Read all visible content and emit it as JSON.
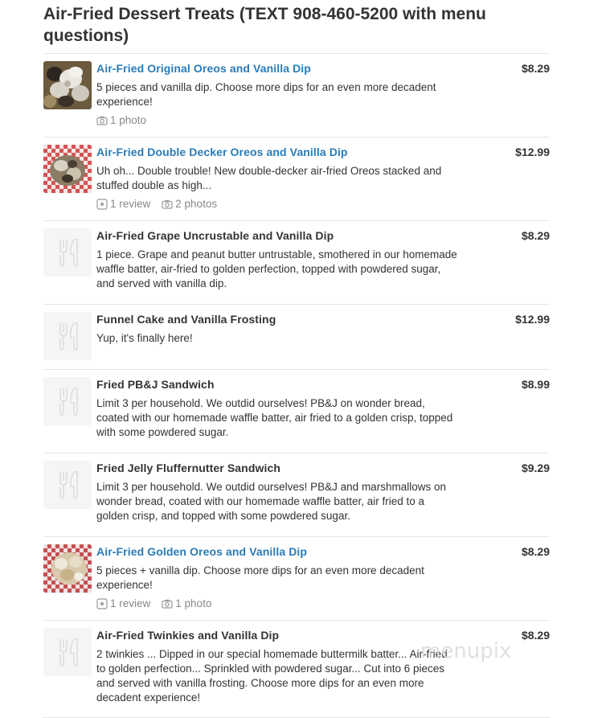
{
  "section": {
    "title": "Air-Fried Dessert Treats (TEXT 908-460-5200 with menu questions)"
  },
  "items": [
    {
      "name": "Air-Fried Original Oreos and Vanilla Dip",
      "price": "$8.29",
      "description": "5 pieces and vanilla dip. Choose more dips for an even more decadent experience!",
      "reviews": "",
      "photos": "1 photo",
      "has_photo": true,
      "thumb_icon": "oreo-photo"
    },
    {
      "name": "Air-Fried Double Decker Oreos and Vanilla Dip",
      "price": "$12.99",
      "description": "Uh oh... Double trouble! New double-decker air-fried Oreos stacked and stuffed double as high...",
      "reviews": "1 review",
      "photos": "2 photos",
      "has_photo": true,
      "thumb_icon": "double-oreo-photo"
    },
    {
      "name": "Air-Fried Grape Uncrustable and Vanilla Dip",
      "price": "$8.29",
      "description": "1 piece. Grape and peanut butter untrustable, smothered in our homemade waffle batter, air-fried to golden perfection, topped with powdered sugar, and served with vanilla dip.",
      "reviews": "",
      "photos": "",
      "has_photo": false,
      "thumb_icon": "fork-knife-icon"
    },
    {
      "name": "Funnel Cake and Vanilla Frosting",
      "price": "$12.99",
      "description": "Yup, it's finally here!",
      "reviews": "",
      "photos": "",
      "has_photo": false,
      "thumb_icon": "fork-knife-icon"
    },
    {
      "name": "Fried PB&J Sandwich",
      "price": "$8.99",
      "description": "Limit 3 per household. We outdid ourselves! PB&J on wonder bread, coated with our homemade waffle batter, air fried to a golden crisp, topped with some powdered sugar.",
      "reviews": "",
      "photos": "",
      "has_photo": false,
      "thumb_icon": "fork-knife-icon"
    },
    {
      "name": "Fried Jelly Fluffernutter Sandwich",
      "price": "$9.29",
      "description": "Limit 3 per household. We outdid ourselves! PB&J and marshmallows on wonder bread, coated with our homemade waffle batter, air fried to a golden crisp, and topped with some powdered sugar.",
      "reviews": "",
      "photos": "",
      "has_photo": false,
      "thumb_icon": "fork-knife-icon"
    },
    {
      "name": "Air-Fried Golden Oreos and Vanilla Dip",
      "price": "$8.29",
      "description": "5 pieces + vanilla dip. Choose more dips for an even more decadent experience!",
      "reviews": "1 review",
      "photos": "1 photo",
      "has_photo": true,
      "thumb_icon": "golden-oreo-photo"
    },
    {
      "name": "Air-Fried Twinkies and Vanilla Dip",
      "price": "$8.29",
      "description": "2 twinkies ... Dipped in our special homemade buttermilk batter... Air-fried to golden perfection... Sprinkled with powdered sugar... Cut into 6 pieces and served with vanilla frosting. Choose more dips for an even more decadent experience!",
      "reviews": "",
      "photos": "",
      "has_photo": false,
      "thumb_icon": "fork-knife-icon"
    }
  ],
  "watermark": "menupix",
  "colors": {
    "link": "#2a7bb6",
    "text": "#333333",
    "meta": "#888888",
    "divider": "#e6e6e6"
  }
}
